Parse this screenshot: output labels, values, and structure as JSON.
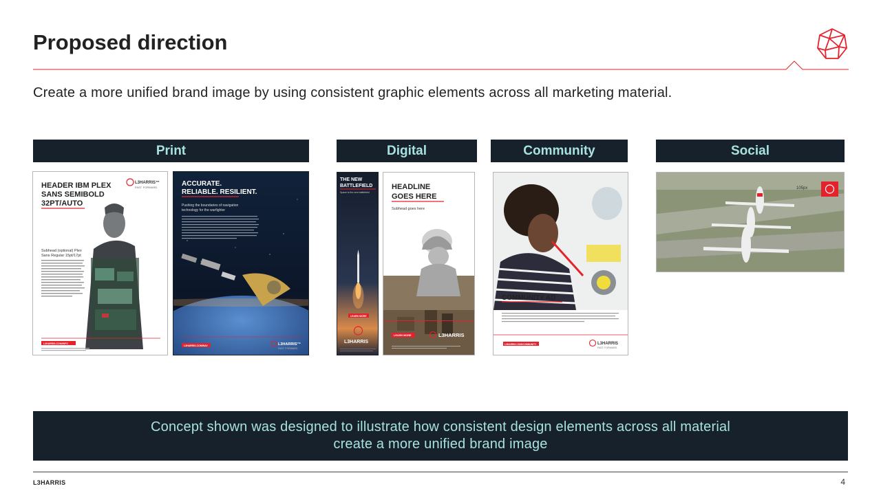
{
  "page": {
    "title": "Proposed direction",
    "subtitle": "Create a more unified brand image by using consistent graphic elements across all marketing material."
  },
  "categories": {
    "print": "Print",
    "digital": "Digital",
    "community": "Community",
    "social": "Social"
  },
  "print_card_1": {
    "header": [
      "HEADER IBM PLEX",
      "SANS SEMIBOLD",
      "32PT/AUTO"
    ],
    "brand": "L3HARRIS™",
    "tagline": "FAST. FORWARD.",
    "subhead": [
      "Subhead (optional) Plex",
      "Sans Regular 15pt/17pt"
    ],
    "button": "L3HARRIS.COM/INFO"
  },
  "print_card_2": {
    "header": [
      "ACCURATE.",
      "RELIABLE. RESILIENT."
    ],
    "subhead": [
      "Pushing the boundaries of navigation",
      "technology for the warfighter"
    ],
    "button": "L3HARRIS.COM/NAV",
    "brand": "L3HARRIS™",
    "tagline": "FAST. FORWARD."
  },
  "digital_card_1": {
    "header": [
      "THE NEW",
      "BATTLEFIELD"
    ],
    "sub": "Space is the new battlefield",
    "button": "LEARN MORE",
    "brand": "L3HARRIS"
  },
  "digital_card_2": {
    "header": [
      "HEADLINE",
      "GOES HERE"
    ],
    "sub": "Subhead goes here",
    "button": "LEARN MORE",
    "brand": "L3HARRIS"
  },
  "community_card": {
    "header": "COMMUNITY AD",
    "sub": "Subhead goes here",
    "button": "L3HARRIS.COM/COMMUNITY",
    "brand": "L3HARRIS",
    "tagline": "FAST. FORWARD."
  },
  "social_card": {
    "label": "105px"
  },
  "concept": {
    "line1": "Concept shown was designed to illustrate how consistent design elements across all material",
    "line2": "create a more unified brand image"
  },
  "footer": {
    "brand": "L3HARRIS",
    "page_number": "4"
  },
  "colors": {
    "accent_red": "#e4222b",
    "navy": "#17212b",
    "teal_text": "#a8e2e0"
  }
}
